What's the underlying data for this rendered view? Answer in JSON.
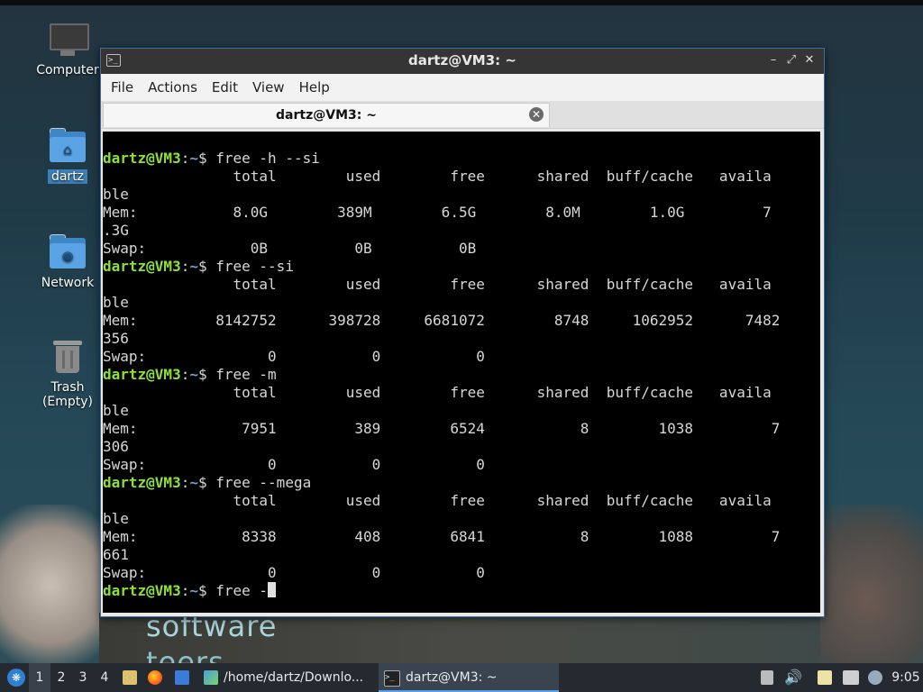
{
  "desktop": {
    "icons": [
      {
        "label": "Computer"
      },
      {
        "label": "dartz"
      },
      {
        "label": "Network"
      },
      {
        "label": "Trash (Empty)"
      }
    ],
    "background_text": [
      "software",
      "teers"
    ]
  },
  "window": {
    "title": "dartz@VM3: ~",
    "menu": [
      "File",
      "Actions",
      "Edit",
      "View",
      "Help"
    ],
    "tab_title": "dartz@VM3: ~"
  },
  "terminal": {
    "user_host": "dartz@VM3",
    "path": "~",
    "lines": [
      {
        "prompt": true,
        "cmd": "$ free -h --si"
      },
      {
        "text": "               total        used        free      shared  buff/cache   availa"
      },
      {
        "text": "ble"
      },
      {
        "text": "Mem:           8.0G        389M        6.5G        8.0M        1.0G         7"
      },
      {
        "text": ".3G"
      },
      {
        "text": "Swap:            0B          0B          0B"
      },
      {
        "prompt": true,
        "cmd": "$ free --si"
      },
      {
        "text": "               total        used        free      shared  buff/cache   availa"
      },
      {
        "text": "ble"
      },
      {
        "text": "Mem:         8142752      398728     6681072        8748     1062952      7482"
      },
      {
        "text": "356"
      },
      {
        "text": "Swap:              0           0           0"
      },
      {
        "prompt": true,
        "cmd": "$ free -m"
      },
      {
        "text": "               total        used        free      shared  buff/cache   availa"
      },
      {
        "text": "ble"
      },
      {
        "text": "Mem:            7951         389        6524           8        1038         7"
      },
      {
        "text": "306"
      },
      {
        "text": "Swap:              0           0           0"
      },
      {
        "prompt": true,
        "cmd": "$ free --mega"
      },
      {
        "text": "               total        used        free      shared  buff/cache   availa"
      },
      {
        "text": "ble"
      },
      {
        "text": "Mem:            8338         408        6841           8        1088         7"
      },
      {
        "text": "661"
      },
      {
        "text": "Swap:              0           0           0"
      },
      {
        "prompt": true,
        "cmd": "$ free -",
        "cursor": true
      }
    ]
  },
  "taskbar": {
    "workspaces": [
      "1",
      "2",
      "3",
      "4"
    ],
    "active_workspace": "1",
    "tasks": [
      {
        "label": "/home/dartz/Downlo...",
        "icon": "image-viewer-icon"
      },
      {
        "label": "dartz@VM3: ~",
        "icon": "terminal-icon"
      }
    ],
    "clock": "9:05",
    "colors": {
      "accent": "#5aa0e6",
      "prompt_user": "#8ae234",
      "prompt_path": "#729fcf"
    }
  }
}
